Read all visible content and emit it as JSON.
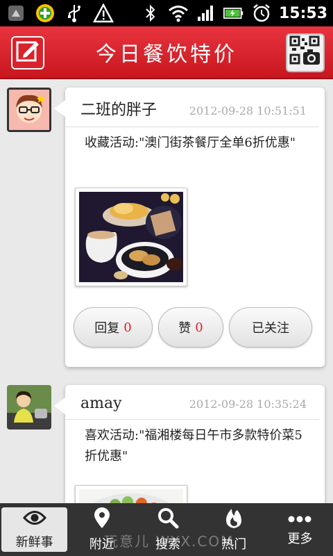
{
  "status_bar": {
    "time": "15:53",
    "left_icons": [
      "app-notification-icon",
      "security-plus-icon",
      "usb-icon",
      "warning-icon"
    ],
    "right_icons": [
      "bluetooth-icon",
      "wifi-icon",
      "signal-icon",
      "battery-charging-icon",
      "alarm-icon"
    ]
  },
  "header": {
    "title": "今日餐饮特价",
    "left_icon": "compose-icon",
    "right_icon": "qr-camera-icon",
    "color": "#d8232c"
  },
  "posts": [
    {
      "username": "二班的胖子",
      "time": "2012-09-28 10:51:51",
      "text": "收藏活动:\"澳门街茶餐厅全单6折优惠\"",
      "has_photo": true,
      "actions": {
        "reply_label": "回复",
        "reply_count": "0",
        "like_label": "赞",
        "like_count": "0",
        "follow_label": "已关注"
      }
    },
    {
      "username": "amay",
      "time": "2012-09-28 10:35:24",
      "text": "喜欢活动:\"福湘楼每日午市多款特价菜5折优惠\"",
      "has_photo": true
    }
  ],
  "bottom_nav": {
    "items": [
      {
        "label": "新鲜事",
        "icon": "eye-icon",
        "active": true
      },
      {
        "label": "附近",
        "icon": "location-pin-icon",
        "active": false
      },
      {
        "label": "搜索",
        "icon": "search-icon",
        "active": false
      },
      {
        "label": "热门",
        "icon": "flame-icon",
        "active": false
      },
      {
        "label": "更多",
        "icon": "more-dots-icon",
        "active": false
      }
    ]
  },
  "watermark": "玩意儿 WYX.COM"
}
